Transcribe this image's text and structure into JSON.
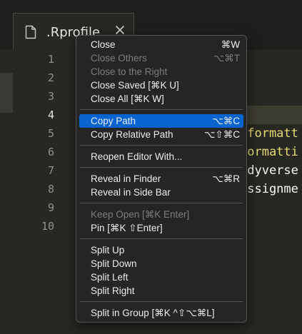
{
  "tab": {
    "title": ".Rprofile"
  },
  "editor": {
    "line_numbers": [
      "1",
      "2",
      "3",
      "4",
      "5",
      "6",
      "7",
      "8",
      "9",
      "10"
    ],
    "active_line": "4",
    "code_fragments": [
      {
        "text": ".formatt",
        "color": "#e6db74"
      },
      {
        "text": "formatti",
        "color": "#e6db74"
      },
      {
        "text": "idyverse",
        "color": "#f8f8f2"
      },
      {
        "text": "assignme",
        "color": "#f8f8f2"
      }
    ]
  },
  "context_menu": {
    "selected_item": "Copy Path",
    "items": [
      {
        "label": "Close",
        "shortcut": "⌘W",
        "enabled": true
      },
      {
        "label": "Close Others",
        "shortcut": "⌥⌘T",
        "enabled": false
      },
      {
        "label": "Close to the Right",
        "shortcut": "",
        "enabled": false
      },
      {
        "label": "Close Saved [⌘K U]",
        "shortcut": "",
        "enabled": true
      },
      {
        "label": "Close All [⌘K W]",
        "shortcut": "",
        "enabled": true
      },
      {
        "label": "Copy Path",
        "shortcut": "⌥⌘C",
        "enabled": true
      },
      {
        "label": "Copy Relative Path",
        "shortcut": "⌥⇧⌘C",
        "enabled": true
      },
      {
        "label": "Reopen Editor With...",
        "shortcut": "",
        "enabled": true
      },
      {
        "label": "Reveal in Finder",
        "shortcut": "⌥⌘R",
        "enabled": true
      },
      {
        "label": "Reveal in Side Bar",
        "shortcut": "",
        "enabled": true
      },
      {
        "label": "Keep Open [⌘K Enter]",
        "shortcut": "",
        "enabled": false
      },
      {
        "label": "Pin [⌘K ⇧Enter]",
        "shortcut": "",
        "enabled": true
      },
      {
        "label": "Split Up",
        "shortcut": "",
        "enabled": true
      },
      {
        "label": "Split Down",
        "shortcut": "",
        "enabled": true
      },
      {
        "label": "Split Left",
        "shortcut": "",
        "enabled": true
      },
      {
        "label": "Split Right",
        "shortcut": "",
        "enabled": true
      },
      {
        "label": "Split in Group [⌘K ^⇧⌥⌘L]",
        "shortcut": "",
        "enabled": true
      }
    ]
  },
  "colors": {
    "editor_background": "#272822",
    "menu_background": "#252526",
    "menu_selection": "#0a64d0",
    "disabled_text": "#7c7c7c"
  },
  "icons": {
    "tab_file": "file-icon",
    "tab_close": "close-icon"
  }
}
